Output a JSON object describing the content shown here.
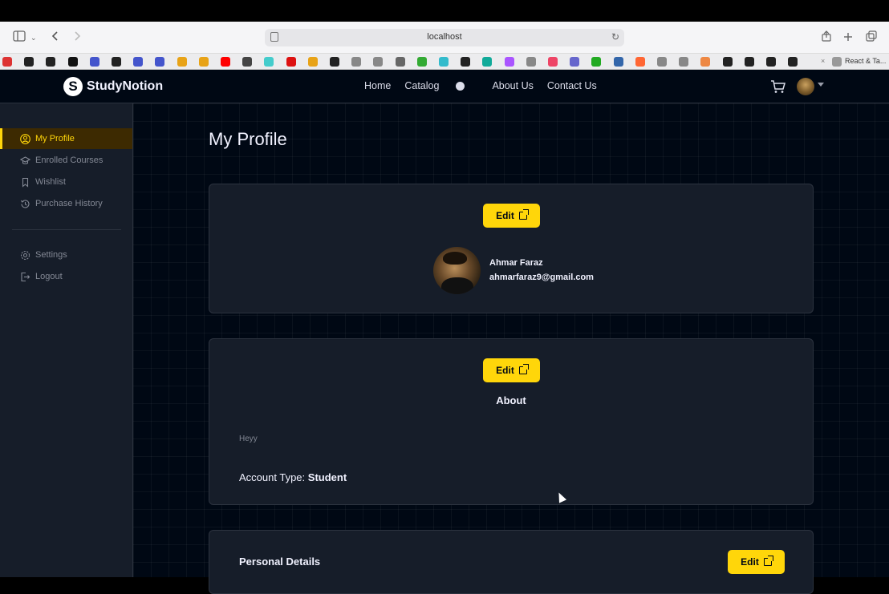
{
  "browser": {
    "url": "localhost",
    "tab_title": "React & Ta...",
    "favicons": [
      "gmail-icon",
      "github-icon",
      "github-icon",
      "m-icon",
      "code-icon",
      "github-icon",
      "code-icon",
      "code-icon",
      "leetcode-icon",
      "leetcode-icon",
      "youtube-icon",
      "openai-icon",
      "link-icon",
      "tuf-icon",
      "leetcode-icon",
      "github-icon",
      "l-icon",
      "a-icon",
      "bars-icon",
      "mongodb-icon",
      "tailwind-icon",
      "chrome-icon",
      "diamond-icon",
      "gradient-icon",
      "u-icon",
      "react-icon",
      "atom-icon",
      "circle-icon",
      "vscode-icon",
      "figma-icon",
      "m-icon",
      "r-icon",
      "triangle-icon",
      "s-icon",
      "s-icon",
      "github-icon",
      "github-icon"
    ]
  },
  "nav": {
    "brand": "StudyNotion",
    "links": [
      "Home",
      "Catalog",
      "About Us",
      "Contact Us"
    ]
  },
  "sidebar": {
    "items": [
      {
        "label": "My Profile",
        "icon": "user-circle-icon",
        "active": true
      },
      {
        "label": "Enrolled Courses",
        "icon": "graduation-cap-icon",
        "active": false
      },
      {
        "label": "Wishlist",
        "icon": "bookmark-icon",
        "active": false
      },
      {
        "label": "Purchase History",
        "icon": "history-icon",
        "active": false
      }
    ],
    "bottom_items": [
      {
        "label": "Settings",
        "icon": "gear-icon"
      },
      {
        "label": "Logout",
        "icon": "logout-icon"
      }
    ]
  },
  "main": {
    "title": "My Profile",
    "profile": {
      "edit_label": "Edit",
      "name": "Ahmar Faraz",
      "email": "ahmarfaraz9@gmail.com"
    },
    "about": {
      "edit_label": "Edit",
      "heading": "About",
      "text": "Heyy",
      "account_type_label": "Account Type:",
      "account_type_value": "Student"
    },
    "personal": {
      "heading": "Personal Details",
      "edit_label": "Edit"
    }
  },
  "colors": {
    "accent": "#FFD60A",
    "bg": "#000814",
    "card": "#161D29"
  }
}
